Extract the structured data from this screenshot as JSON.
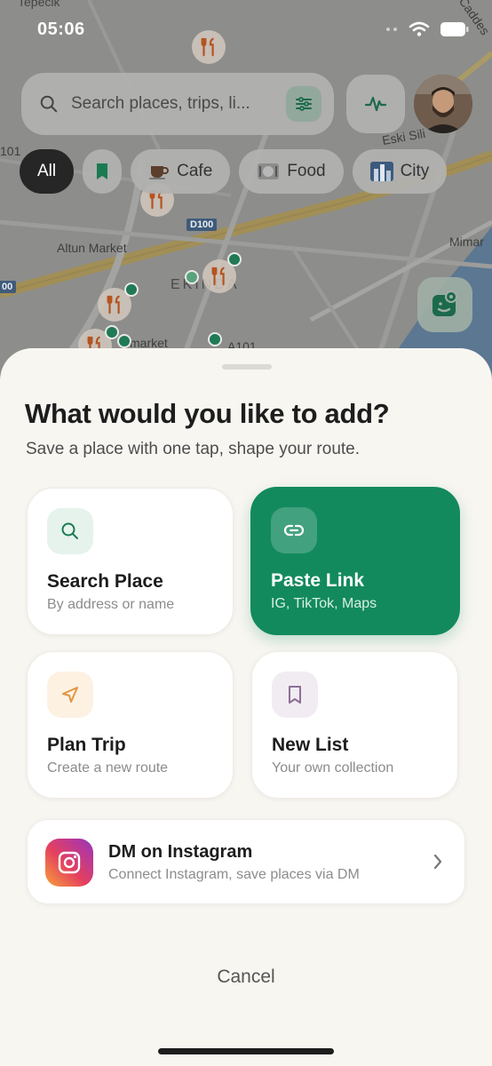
{
  "status_bar": {
    "time": "05:06",
    "icons": [
      "wifi-icon",
      "battery-icon"
    ]
  },
  "map": {
    "labels": [
      "Tepecik",
      "Eski Sili",
      "Altun Market",
      "EKINDA",
      "Mimar",
      "Caddes",
      "market",
      "101",
      "A101"
    ],
    "road_shield": "D100",
    "road_shield_left": "00"
  },
  "search": {
    "placeholder": "Search places, trips, li..."
  },
  "chips": [
    {
      "label": "All",
      "active": true
    },
    {
      "label": "",
      "icon": "bookmark-icon"
    },
    {
      "label": "Cafe",
      "icon": "coffee-icon"
    },
    {
      "label": "Food",
      "icon": "food-icon"
    },
    {
      "label": "City",
      "icon": "city-icon"
    }
  ],
  "sheet": {
    "title": "What would you like to add?",
    "subtitle": "Save a place with one tap, shape your route.",
    "cards": [
      {
        "title": "Search Place",
        "subtitle": "By address or name",
        "icon": "search-icon"
      },
      {
        "title": "Paste Link",
        "subtitle": "IG, TikTok, Maps",
        "icon": "link-icon"
      },
      {
        "title": "Plan Trip",
        "subtitle": "Create a new route",
        "icon": "navigation-arrow-icon"
      },
      {
        "title": "New List",
        "subtitle": "Your own collection",
        "icon": "bookmark-icon"
      }
    ],
    "instagram": {
      "title": "DM on Instagram",
      "subtitle": "Connect Instagram, save places via DM"
    },
    "cancel": "Cancel"
  },
  "colors": {
    "accent": "#138a5e",
    "sheet_bg": "#f8f6f1"
  }
}
